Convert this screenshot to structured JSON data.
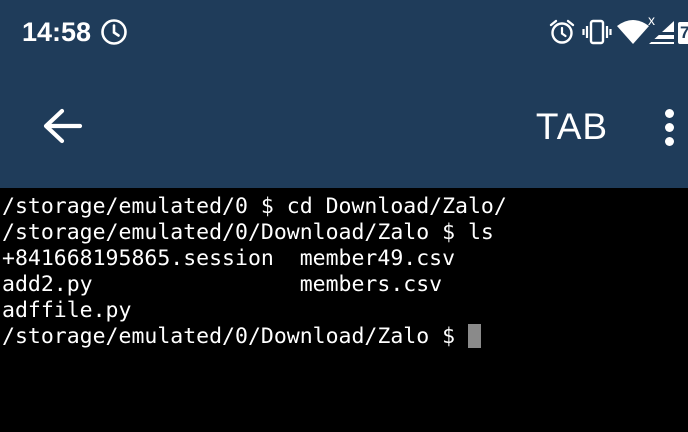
{
  "status_bar": {
    "time": "14:58",
    "icons": [
      "clock-icon",
      "alarm-icon",
      "vibrate-icon",
      "wifi-icon",
      "signal-icon",
      "battery-icon"
    ],
    "signal_label": "x",
    "battery_label": "7"
  },
  "app_bar": {
    "back_icon": "arrow-left-icon",
    "tab_label": "TAB",
    "overflow_icon": "more-vertical-icon"
  },
  "terminal": {
    "lines": [
      "/storage/emulated/0 $ cd Download/Zalo/",
      "/storage/emulated/0/Download/Zalo $ ls",
      "+841668195865.session  member49.csv",
      "add2.py                members.csv",
      "adffile.py",
      "/storage/emulated/0/Download/Zalo $ "
    ]
  },
  "colors": {
    "bar_background": "#1f3c5a",
    "terminal_background": "#000000",
    "terminal_text": "#ffffff",
    "cursor": "#8a8a8a"
  }
}
